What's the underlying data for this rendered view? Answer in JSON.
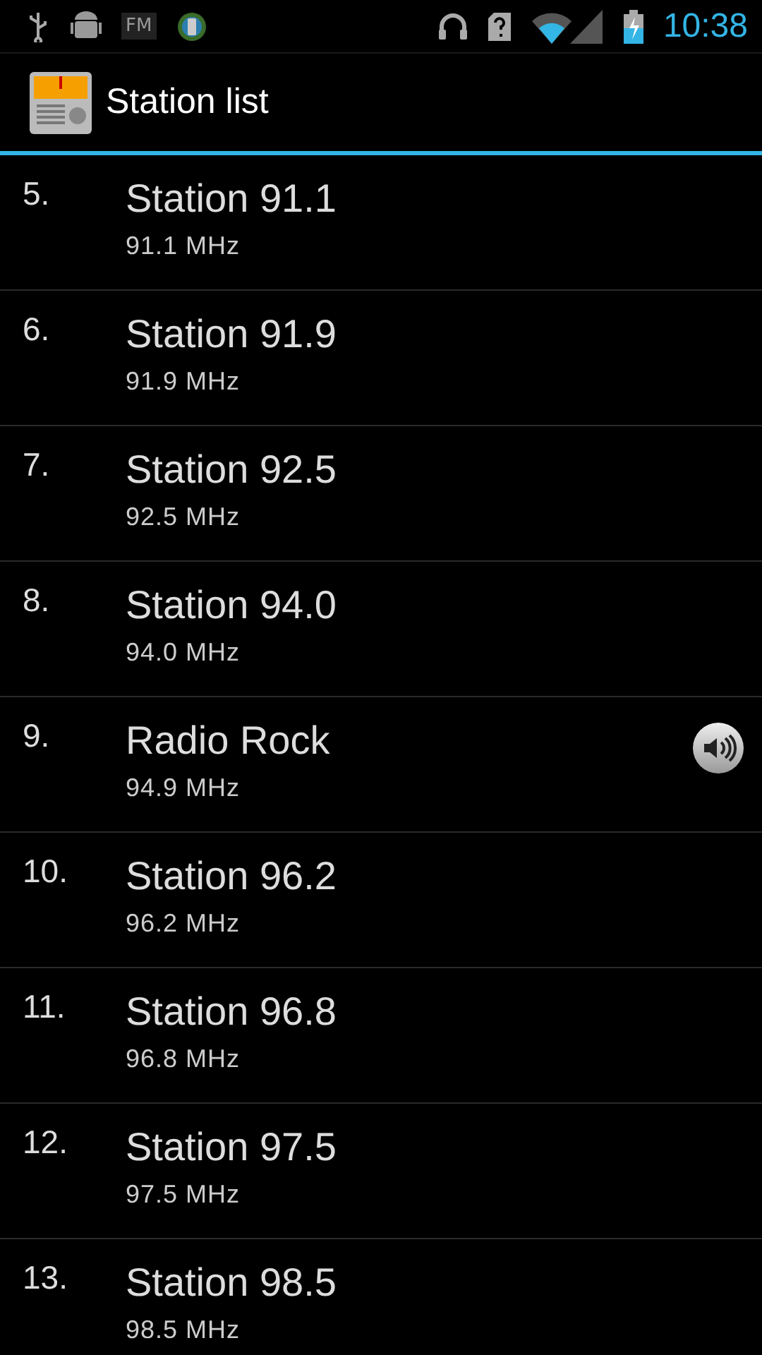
{
  "status_bar": {
    "fm_label": "FM",
    "time": "10:38"
  },
  "action_bar": {
    "title": "Station list"
  },
  "stations": [
    {
      "number": "5.",
      "name": "Station 91.1",
      "frequency": "91.1 MHz",
      "playing": false
    },
    {
      "number": "6.",
      "name": "Station 91.9",
      "frequency": "91.9 MHz",
      "playing": false
    },
    {
      "number": "7.",
      "name": "Station 92.5",
      "frequency": "92.5 MHz",
      "playing": false
    },
    {
      "number": "8.",
      "name": "Station 94.0",
      "frequency": "94.0 MHz",
      "playing": false
    },
    {
      "number": "9.",
      "name": "Radio Rock",
      "frequency": "94.9 MHz",
      "playing": true
    },
    {
      "number": "10.",
      "name": "Station 96.2",
      "frequency": "96.2 MHz",
      "playing": false
    },
    {
      "number": "11.",
      "name": "Station 96.8",
      "frequency": "96.8 MHz",
      "playing": false
    },
    {
      "number": "12.",
      "name": "Station 97.5",
      "frequency": "97.5 MHz",
      "playing": false
    },
    {
      "number": "13.",
      "name": "Station 98.5",
      "frequency": "98.5 MHz",
      "playing": false
    }
  ]
}
